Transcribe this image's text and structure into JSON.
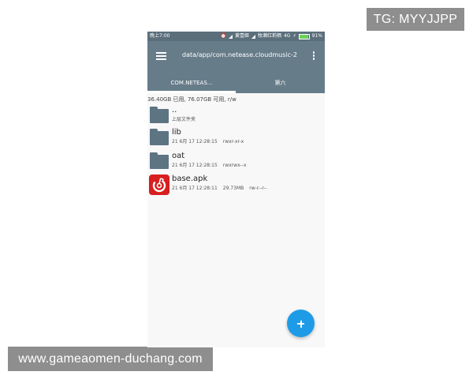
{
  "watermarks": {
    "tg": "TG: MYYJJPP",
    "url": "www.gameaomen-duchang.com"
  },
  "statusbar": {
    "time": "晚上7:00",
    "carrier_1": "黄壹姬",
    "carrier_2": "牧濑红莉栖",
    "network": "4G",
    "battery": "91%",
    "battery_level": 0.91,
    "battery_color": "#6bd35a"
  },
  "appbar": {
    "path": "data/app/com.netease.cloudmusic-2",
    "tabs": [
      {
        "label": "COM.NETEAS..."
      },
      {
        "label": "第六"
      }
    ],
    "color": "#667c89"
  },
  "storage": {
    "info": "36.40GB 已用, 76.07GB 可用, r/w"
  },
  "files": [
    {
      "name": "..",
      "subtitle": "上层文件夹",
      "icon": "folder-icon"
    },
    {
      "name": "lib",
      "date": "21 6月 17 12:28:15",
      "perm": "rwxr-xr-x",
      "icon": "folder-icon"
    },
    {
      "name": "oat",
      "date": "21 6月 17 12:28:15",
      "perm": "rwxrwx--x",
      "icon": "folder-icon"
    },
    {
      "name": "base.apk",
      "date": "21 6月 17 12:28:11",
      "size": "29.73MB",
      "perm": "rw-r--r--",
      "icon": "netease-music-icon"
    }
  ],
  "fab": {
    "icon": "plus-icon",
    "color": "#1e9be6"
  }
}
